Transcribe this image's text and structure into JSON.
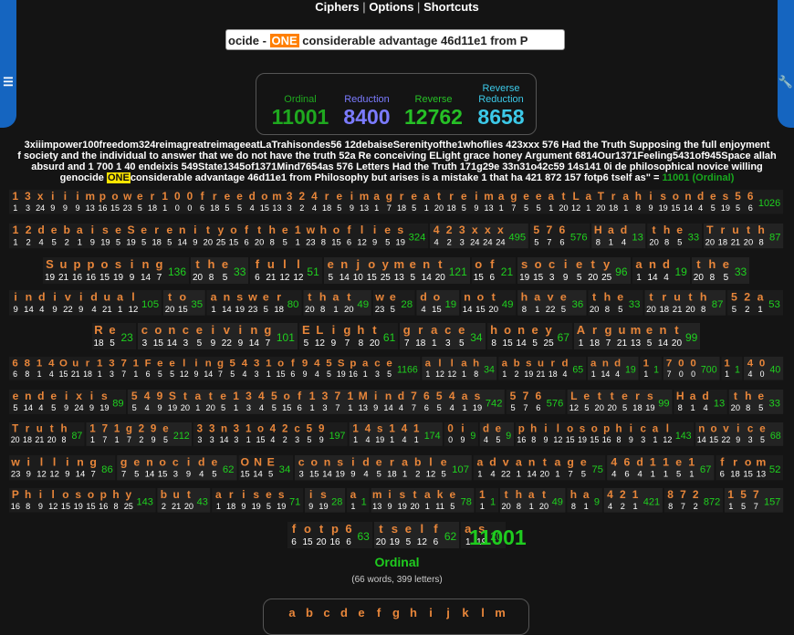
{
  "menu": {
    "ciphers": "Ciphers",
    "options": "Options",
    "shortcuts": "Shortcuts",
    "sep": "|"
  },
  "search": {
    "before": "ocide - ",
    "highlight": "ONE",
    "after": " considerable advantage 46d11e1 from P"
  },
  "totals": [
    {
      "label": "Ordinal",
      "value": "11001",
      "color": "#1fa81f"
    },
    {
      "label": "Reduction",
      "value": "8400",
      "color": "#7b7bff"
    },
    {
      "label": "Reverse",
      "value": "12762",
      "color": "#26c026"
    },
    {
      "label": "Reverse\nReduction",
      "value": "8658",
      "color": "#3cc9e8"
    }
  ],
  "phrase": {
    "line1": "3xiiimpower100freedom324reimagreatreimageeatLaTrahisondes56 12debaiseSerenityofthe1whoflies 423xxx 576 Had the Truth Supposing the full enjoyment",
    "line2": "f society and the individual to answer that we do not have the truth 52a Re conceiving ELight grace honey Argument 6814Our1371Feeling5431of945Space allah",
    "line3": "absurd and 1 700 1 40 endeixis 549State1345of1371Mind7654as 576 Letters Had the Truth 171g29e 33n31o42c59 14s141 0i de philosophical novice willing",
    "line4_before": "genocide ",
    "line4_highlight": "ONE",
    "line4_after": "considerable advantage 46d11e1 from Philosophy but arises is a mistake 1 that ha 421 872 157 fotp6 tself as\" = ",
    "line4_result": "11001 (Ordinal)"
  },
  "rows": [
    [
      {
        "t": "13xiiimpower100freedom324reimagreatreimageeatLaTrahisondes56",
        "s": "1026"
      }
    ],
    [
      {
        "t": "12debaiseSerenityofthe1whoflies",
        "s": "324"
      },
      {
        "t": "423xxx",
        "s": "495"
      },
      {
        "t": "576",
        "s": "576"
      },
      {
        "t": "Had",
        "s": "13"
      },
      {
        "t": "the",
        "s": "33"
      },
      {
        "t": "Truth",
        "s": "87"
      }
    ],
    [
      {
        "t": "Supposing",
        "s": "136"
      },
      {
        "t": "the",
        "s": "33"
      },
      {
        "t": "full",
        "s": "51"
      },
      {
        "t": "enjoyment",
        "s": "121"
      },
      {
        "t": "of",
        "s": "21"
      },
      {
        "t": "society",
        "s": "96"
      },
      {
        "t": "and",
        "s": "19"
      },
      {
        "t": "the",
        "s": "33"
      }
    ],
    [
      {
        "t": "individual",
        "s": "105"
      },
      {
        "t": "to",
        "s": "35"
      },
      {
        "t": "answer",
        "s": "80"
      },
      {
        "t": "that",
        "s": "49"
      },
      {
        "t": "we",
        "s": "28"
      },
      {
        "t": "do",
        "s": "19"
      },
      {
        "t": "not",
        "s": "49"
      },
      {
        "t": "have",
        "s": "36"
      },
      {
        "t": "the",
        "s": "33"
      },
      {
        "t": "truth",
        "s": "87"
      },
      {
        "t": "52a",
        "s": "53"
      }
    ],
    [
      {
        "t": "Re",
        "s": "23"
      },
      {
        "t": "conceiving",
        "s": "101"
      },
      {
        "t": "ELight",
        "s": "61"
      },
      {
        "t": "grace",
        "s": "34"
      },
      {
        "t": "honey",
        "s": "67"
      },
      {
        "t": "Argument",
        "s": "99"
      }
    ],
    [
      {
        "t": "6814Our1371Feeling5431of945Space",
        "s": "1166"
      },
      {
        "t": "allah",
        "s": "34"
      },
      {
        "t": "absurd",
        "s": "65"
      },
      {
        "t": "and",
        "s": "19"
      },
      {
        "t": "1",
        "s": "1"
      },
      {
        "t": "700",
        "s": "700"
      },
      {
        "t": "1",
        "s": "1"
      },
      {
        "t": "40",
        "s": "40"
      }
    ],
    [
      {
        "t": "endeixis",
        "s": "89"
      },
      {
        "t": "549State1345of1371Mind7654as",
        "s": "742"
      },
      {
        "t": "576",
        "s": "576"
      },
      {
        "t": "Letters",
        "s": "99"
      },
      {
        "t": "Had",
        "s": "13"
      },
      {
        "t": "the",
        "s": "33"
      }
    ],
    [
      {
        "t": "Truth",
        "s": "87"
      },
      {
        "t": "171g29e",
        "s": "212"
      },
      {
        "t": "33n31o42c59",
        "s": "197"
      },
      {
        "t": "14s141",
        "s": "174"
      },
      {
        "t": "0i",
        "s": "9"
      },
      {
        "t": "de",
        "s": "9"
      },
      {
        "t": "philosophical",
        "s": "143"
      },
      {
        "t": "novice",
        "s": "68"
      }
    ],
    [
      {
        "t": "willing",
        "s": "86"
      },
      {
        "t": "genocide",
        "s": "62"
      },
      {
        "t": "ONE",
        "s": "34"
      },
      {
        "t": "considerable",
        "s": "107"
      },
      {
        "t": "advantage",
        "s": "75"
      },
      {
        "t": "46d11e1",
        "s": "67"
      },
      {
        "t": "from",
        "s": "52"
      }
    ],
    [
      {
        "t": "Philosophy",
        "s": "143"
      },
      {
        "t": "but",
        "s": "43"
      },
      {
        "t": "arises",
        "s": "71"
      },
      {
        "t": "is",
        "s": "28"
      },
      {
        "t": "a",
        "s": "1"
      },
      {
        "t": "mistake",
        "s": "78"
      },
      {
        "t": "1",
        "s": "1"
      },
      {
        "t": "that",
        "s": "49"
      },
      {
        "t": "ha",
        "s": "9"
      },
      {
        "t": "421",
        "s": "421"
      },
      {
        "t": "872",
        "s": "872"
      },
      {
        "t": "157",
        "s": "157"
      }
    ],
    [
      {
        "t": "fotp6",
        "s": "63"
      },
      {
        "t": "tself",
        "s": "62"
      },
      {
        "t": "as",
        "s": "20"
      }
    ]
  ],
  "final_total": "11001",
  "cipher_name": "Ordinal",
  "counts": "(66 words, 399 letters)",
  "alphabet": [
    "a",
    "b",
    "c",
    "d",
    "e",
    "f",
    "g",
    "h",
    "i",
    "j",
    "k",
    "l",
    "m"
  ]
}
